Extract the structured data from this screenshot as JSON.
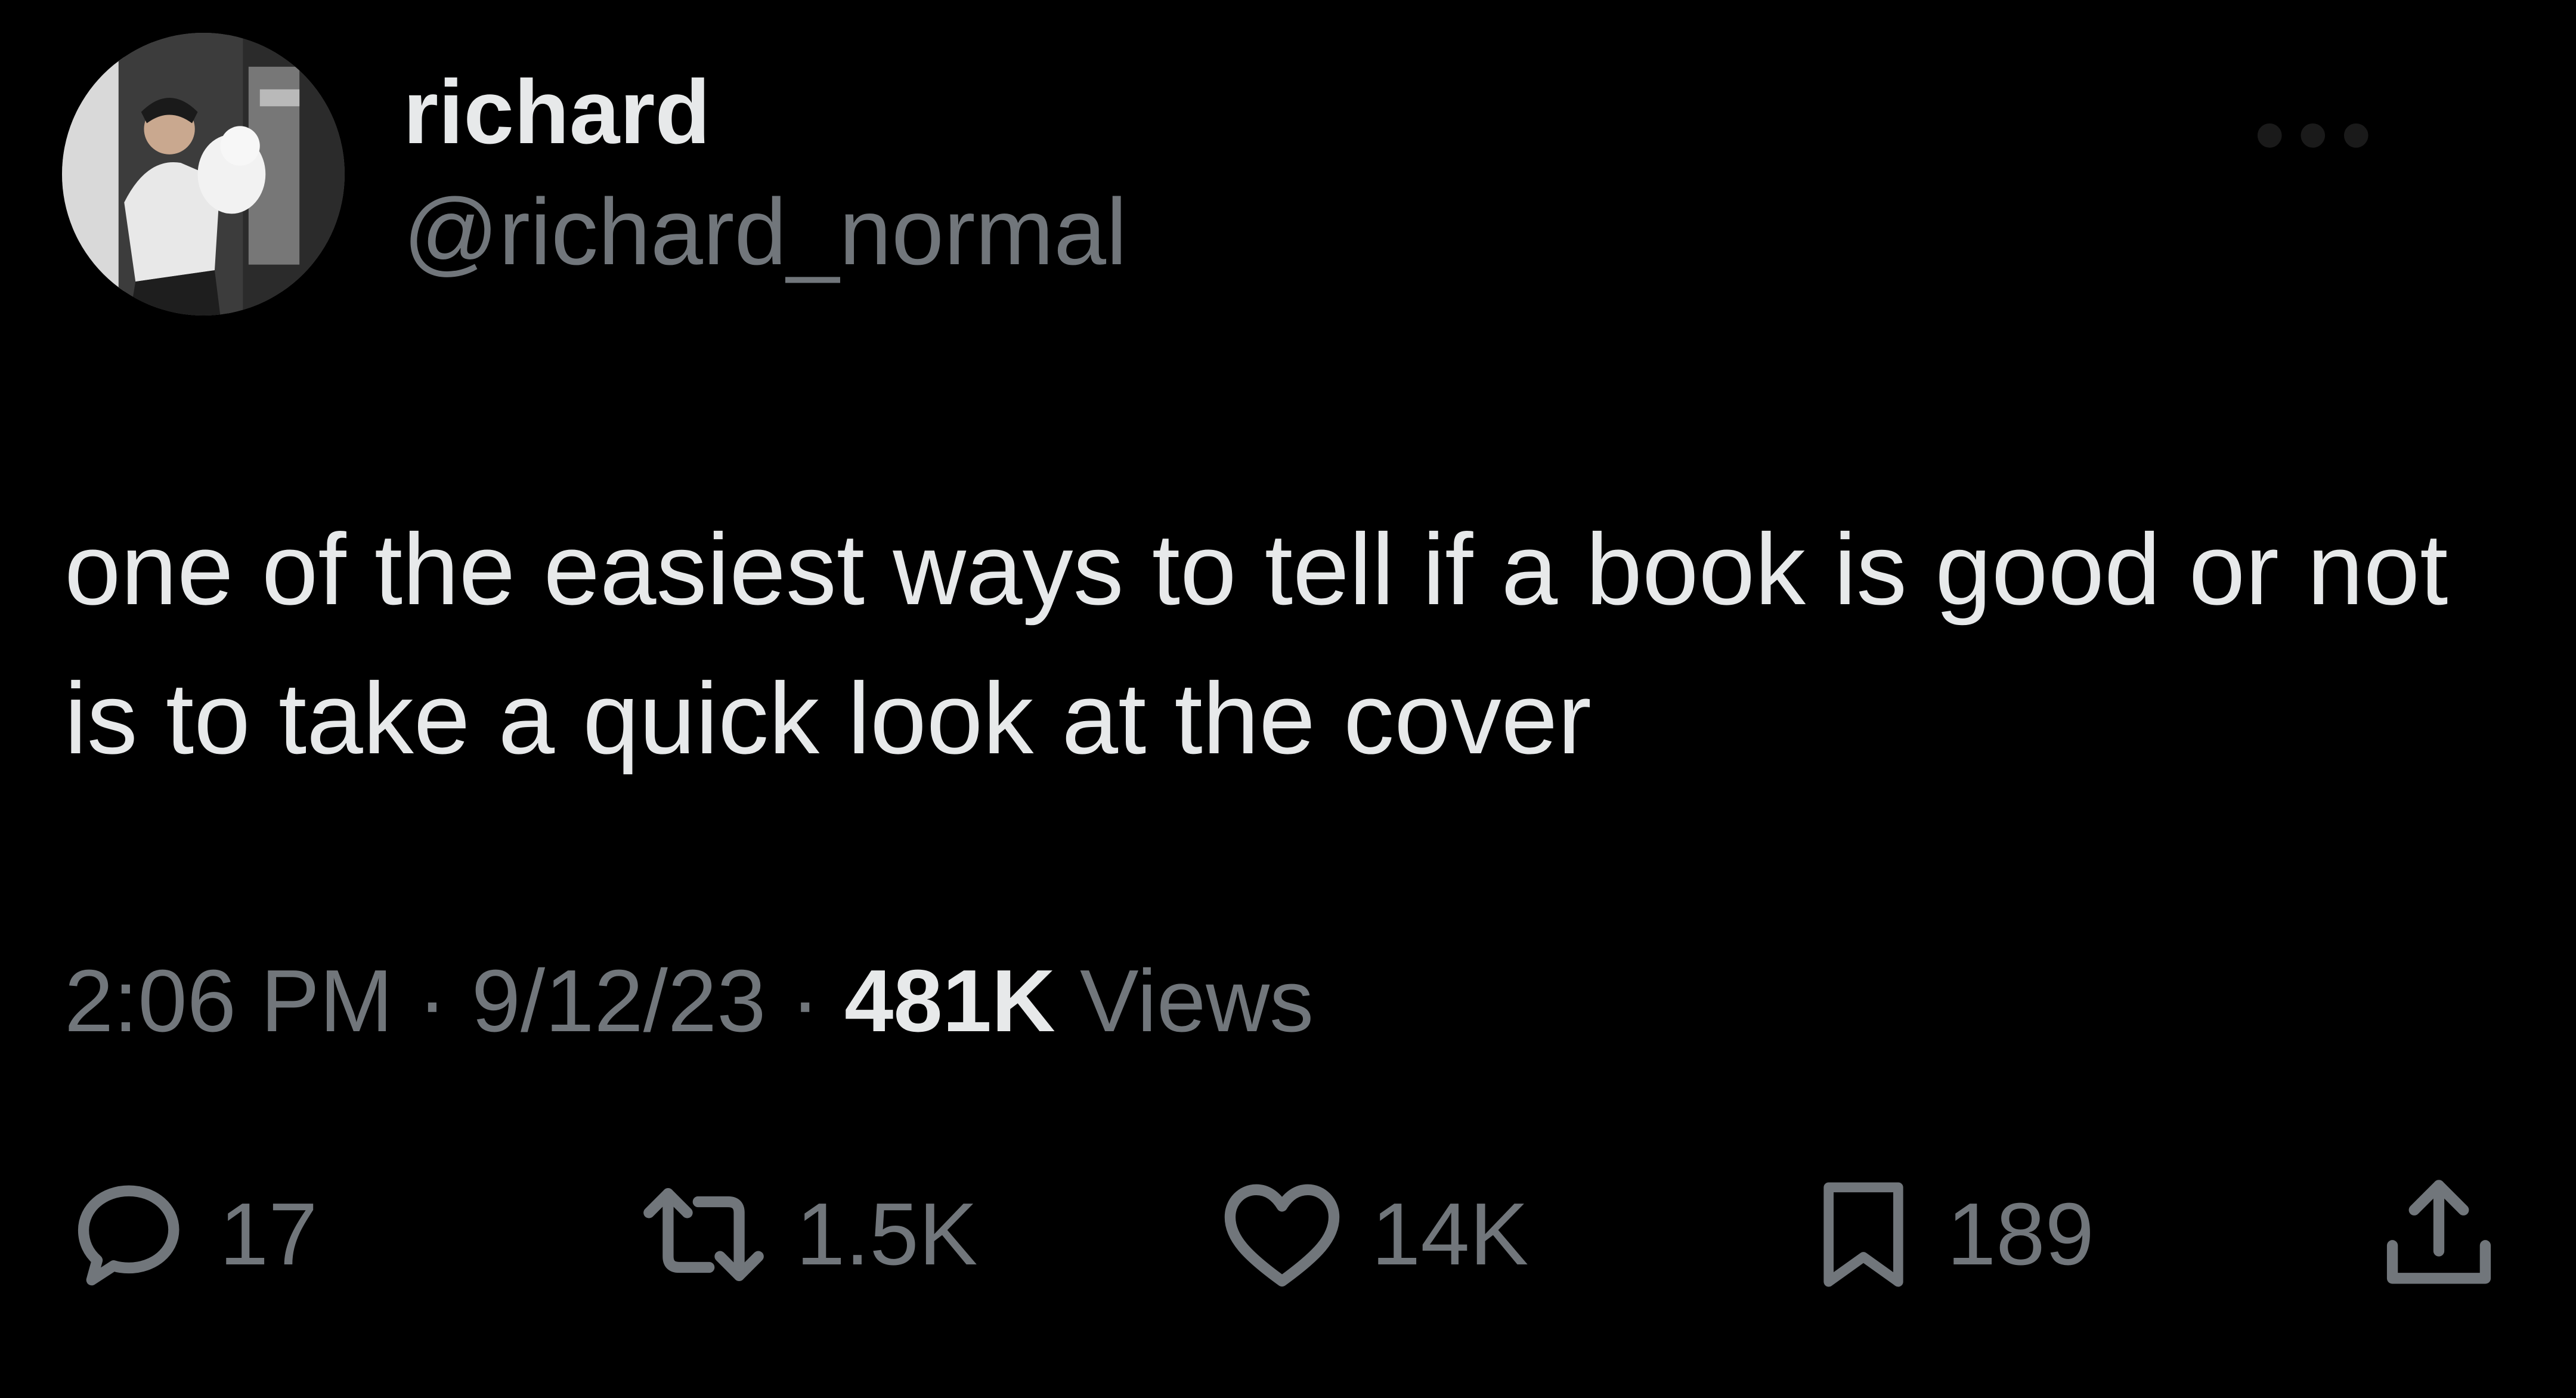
{
  "author": {
    "display_name": "richard",
    "handle": "@richard_normal",
    "avatar_icon": "person-holding-plush-photo"
  },
  "tweet": {
    "text": "one of the easiest ways to tell if a book is good or not is to take a quick look at the cover"
  },
  "meta": {
    "time": "2:06 PM",
    "separator": " · ",
    "date": "9/12/23",
    "views_count": "481K",
    "views_label": " Views"
  },
  "actions": {
    "reply": {
      "icon": "reply-icon",
      "count": "17"
    },
    "retweet": {
      "icon": "retweet-icon",
      "count": "1.5K"
    },
    "like": {
      "icon": "heart-icon",
      "count": "14K"
    },
    "bookmark": {
      "icon": "bookmark-icon",
      "count": "189"
    },
    "share": {
      "icon": "share-icon"
    }
  },
  "colors": {
    "background": "#000000",
    "primary_text": "#e7e9ea",
    "secondary_text": "#71767b"
  }
}
